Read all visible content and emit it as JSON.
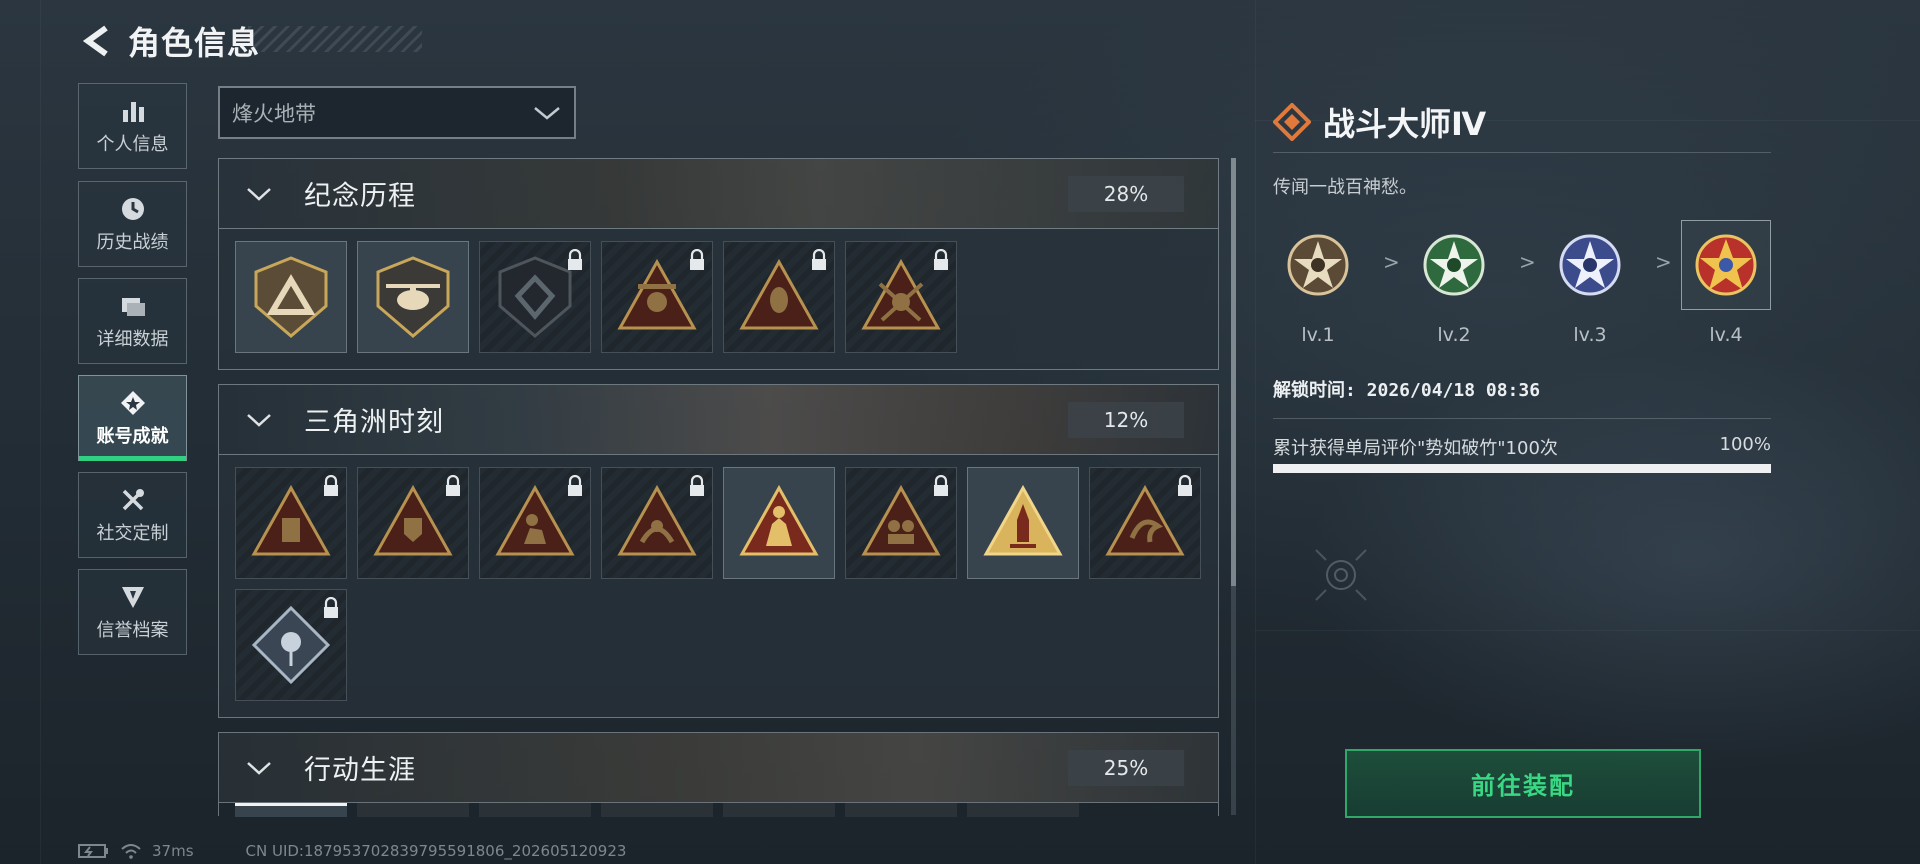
{
  "header": {
    "title": "角色信息"
  },
  "nav": [
    {
      "label": "个人信息",
      "icon": "bar-chart-icon",
      "active": false
    },
    {
      "label": "历史战绩",
      "icon": "clock-icon",
      "active": false
    },
    {
      "label": "详细数据",
      "icon": "folder-icon",
      "active": false
    },
    {
      "label": "账号成就",
      "icon": "achievement-icon",
      "active": true
    },
    {
      "label": "社交定制",
      "icon": "tools-icon",
      "active": false
    },
    {
      "label": "信誉档案",
      "icon": "shield-badge-icon",
      "active": false
    }
  ],
  "mode_select": {
    "value": "烽火地带"
  },
  "sections": [
    {
      "title": "纪念历程",
      "percent": "28%"
    },
    {
      "title": "三角洲时刻",
      "percent": "12%"
    },
    {
      "title": "行动生涯",
      "percent": "25%"
    }
  ],
  "detail": {
    "title": "战斗大师Ⅳ",
    "description": "传闻一战百神愁。",
    "levels": [
      "lv.1",
      "lv.2",
      "lv.3",
      "lv.4"
    ],
    "separator": ">",
    "unlock_time": "解锁时间: 2026/04/18 08:36",
    "condition": "累计获得单局评价\"势如破竹\"100次",
    "progress_text": "100%",
    "progress": 1.0,
    "equip_label": "前往装配"
  },
  "status_bar": {
    "ping": "37ms",
    "uid": "CN UID:18795370283979559​1806_202605120923"
  },
  "colors": {
    "accent_green": "#2fd180",
    "badge_gold": "#c9a75a",
    "title_orange": "#e07a3c"
  }
}
